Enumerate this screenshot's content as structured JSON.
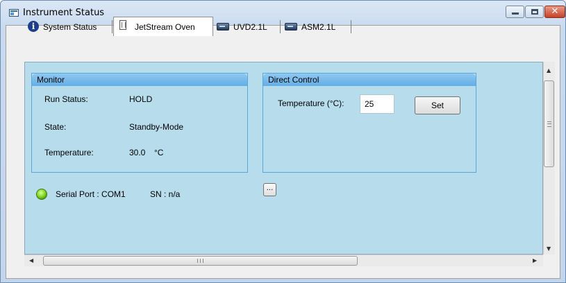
{
  "window": {
    "title": "Instrument Status",
    "controls": {
      "minimize": "minimize-icon",
      "maximize": "maximize-icon",
      "close": "close-icon",
      "close_glyph": "✕"
    }
  },
  "tabs": [
    {
      "label": "System Status",
      "icon": "info-icon",
      "active": false
    },
    {
      "label": "JetStream Oven",
      "icon": "oven-icon",
      "active": true
    },
    {
      "label": "UVD2.1L",
      "icon": "module-icon",
      "active": false
    },
    {
      "label": "ASM2.1L",
      "icon": "module-icon",
      "active": false
    }
  ],
  "monitor": {
    "title": "Monitor",
    "rows": [
      {
        "label": "Run Status:",
        "value": "HOLD"
      },
      {
        "label": "State:",
        "value": "Standby-Mode"
      },
      {
        "label": "Temperature:",
        "value": "30.0",
        "unit": "°C"
      }
    ]
  },
  "direct_control": {
    "title": "Direct Control",
    "temperature_label": "Temperature (°C):",
    "temperature_value": "25",
    "set_label": "Set"
  },
  "connection": {
    "serial_port_text": "Serial Port : COM1",
    "sn_text": "SN :  n/a",
    "status_color": "#7fd61c",
    "more_button": "..."
  },
  "scrollbars": {
    "up": "▲",
    "down": "▼",
    "left": "◀",
    "right": "▶"
  },
  "colors": {
    "panel_background": "#b7dcec",
    "group_header": "#62aee6",
    "status_led": "#7fd61c"
  }
}
